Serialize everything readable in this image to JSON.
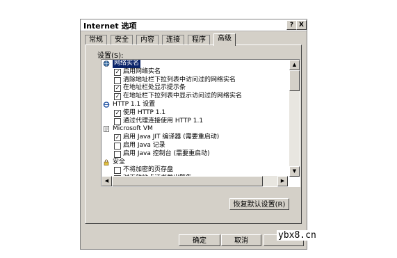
{
  "dialog": {
    "title": "Internet 选项",
    "help_glyph": "?",
    "close_glyph": "X"
  },
  "tabs": [
    "常规",
    "安全",
    "内容",
    "连接",
    "程序",
    "高级"
  ],
  "active_tab": "高级",
  "settings_label": "设置(S):",
  "rows": [
    {
      "type": "group",
      "icon": "globe-icon",
      "text": "网络实名",
      "selected": true
    },
    {
      "type": "item",
      "checked": true,
      "text": "启用网络实名"
    },
    {
      "type": "item",
      "checked": false,
      "text": "清除地址栏下拉列表中访问过的网络实名"
    },
    {
      "type": "item",
      "checked": true,
      "text": "在地址栏处显示提示条"
    },
    {
      "type": "item",
      "checked": true,
      "text": "在地址栏下拉列表中显示访问过的网络实名"
    },
    {
      "type": "group",
      "icon": "ie-icon",
      "text": "HTTP 1.1 设置",
      "selected": false
    },
    {
      "type": "item",
      "checked": true,
      "text": "使用 HTTP 1.1"
    },
    {
      "type": "item",
      "checked": false,
      "text": "通过代理连接使用 HTTP 1.1"
    },
    {
      "type": "group",
      "icon": "document-icon",
      "text": "Microsoft VM",
      "selected": false
    },
    {
      "type": "item",
      "checked": true,
      "text": "启用 Java JIT 编译器 (需要重启动)"
    },
    {
      "type": "item",
      "checked": false,
      "text": "启用 Java 记录"
    },
    {
      "type": "item",
      "checked": false,
      "text": "启用 Java 控制台 (需要重启动)"
    },
    {
      "type": "group",
      "icon": "lock-icon",
      "text": "安全",
      "selected": false
    },
    {
      "type": "item",
      "checked": false,
      "text": "不将加密的页存盘"
    },
    {
      "type": "item",
      "checked": true,
      "text": "对无效站点证书发出警告"
    }
  ],
  "restore_defaults_label": "恢复默认设置(R)",
  "ok_label": "确定",
  "cancel_label": "取消",
  "watermark": "ybx8.cn",
  "colors": {
    "selection": "#0a246a",
    "face": "#d4d0c8"
  }
}
